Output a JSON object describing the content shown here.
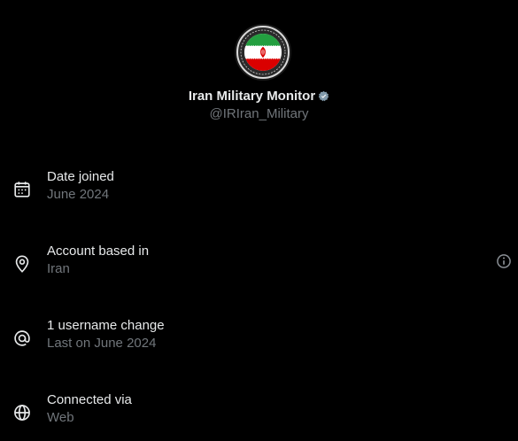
{
  "profile": {
    "display_name": "Iran Military Monitor",
    "handle": "@IRIran_Military",
    "badge_icon": "gray-verified-badge-icon",
    "avatar_icon": "iran-flag-emblem-avatar"
  },
  "details": [
    {
      "icon": "calendar-icon",
      "label": "Date joined",
      "value": "June 2024"
    },
    {
      "icon": "location-pin-icon",
      "label": "Account based in",
      "value": "Iran",
      "extra_icon": "info-icon"
    },
    {
      "icon": "at-sign-icon",
      "label": "1 username change",
      "value": "Last on June 2024"
    },
    {
      "icon": "globe-icon",
      "label": "Connected via",
      "value": "Web"
    }
  ],
  "colors": {
    "background": "#000000",
    "primary_text": "#e7e9ea",
    "secondary_text": "#71767b"
  }
}
